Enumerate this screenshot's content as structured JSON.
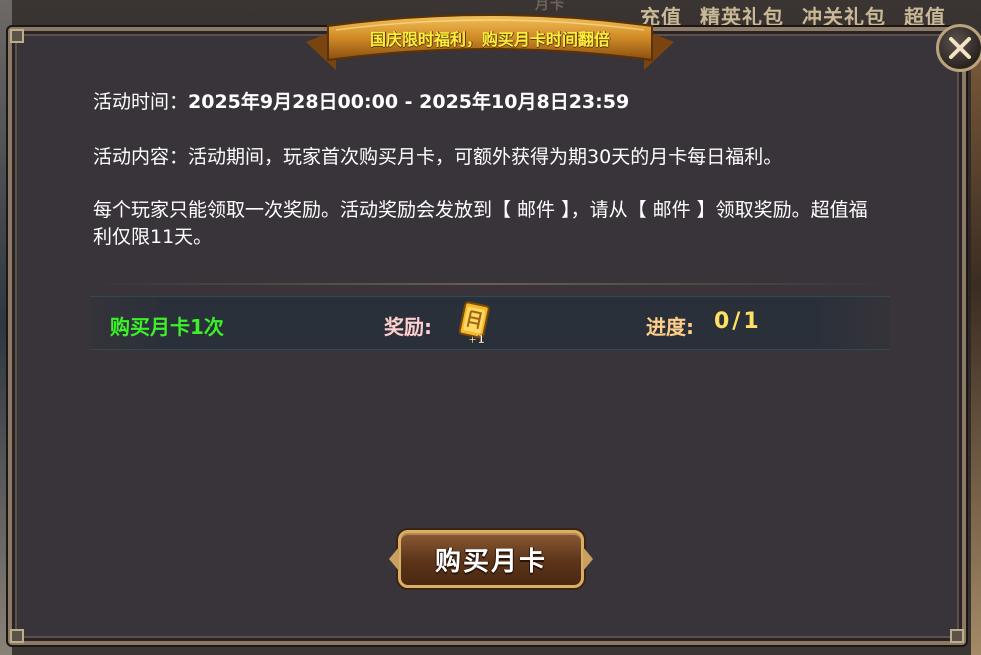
{
  "background": {
    "tabs": [
      "充值",
      "精英礼包",
      "冲关礼包",
      "超值"
    ],
    "faded_tab": "月卡"
  },
  "popup": {
    "ribbon_title": "国庆限时福利，购买月卡时间翻倍",
    "activity_time_label": "活动时间：",
    "activity_time_value": "2025年9月28日00:00 - 2025年10月8日23:59",
    "activity_content_label": "活动内容：",
    "activity_content_value": "活动期间，玩家首次购买月卡，可额外获得为期30天的月卡每日福利。",
    "note": "每个玩家只能领取一次奖励。活动奖励会发放到【 邮件 】，请从【 邮件 】领取奖励。超值福利仅限11天。",
    "task": {
      "name": "购买月卡1次",
      "reward_label": "奖励:",
      "reward_item_icon": "month-card-ticket-icon",
      "reward_count": "+1",
      "progress_label": "进度:",
      "progress_value": "0/1",
      "progress_current": 0,
      "progress_total": 1
    },
    "buy_button_label": "购买月卡"
  },
  "colors": {
    "task_name": "#3cf02a",
    "ribbon_text": "#ffee3a",
    "progress_value": "#ffe060",
    "panel_bg": "#39343a"
  }
}
